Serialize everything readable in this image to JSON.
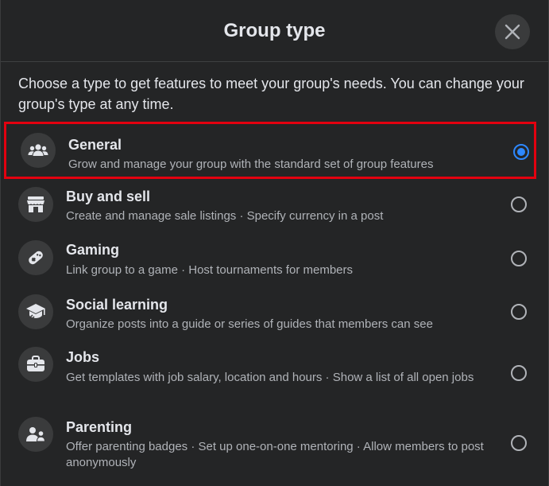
{
  "dialog": {
    "title": "Group type",
    "intro": "Choose a type to get features to meet your group's needs. You can change your group's type at any time.",
    "close_icon": "close-icon"
  },
  "options": [
    {
      "title": "General",
      "description": "Grow and manage your group with the standard set of group features",
      "icon": "people-group-icon",
      "selected": true
    },
    {
      "title": "Buy and sell",
      "description": "Create and manage sale listings · Specify currency in a post",
      "icon": "storefront-icon",
      "selected": false
    },
    {
      "title": "Gaming",
      "description": "Link group to a game · Host tournaments for members",
      "icon": "game-controller-icon",
      "selected": false
    },
    {
      "title": "Social learning",
      "description": "Organize posts into a guide or series of guides that members can see",
      "icon": "graduation-cap-icon",
      "selected": false
    },
    {
      "title": "Jobs",
      "description": "Get templates with job salary, location and hours · Show a list of all open jobs",
      "icon": "briefcase-icon",
      "selected": false
    },
    {
      "title": "Parenting",
      "description": "Offer parenting badges · Set up one-on-one mentoring · Allow members to post anonymously",
      "icon": "parent-child-icon",
      "selected": false
    }
  ],
  "colors": {
    "background": "#242526",
    "accent": "#2d88ff",
    "highlight_border": "#e3000f",
    "primary_text": "#e4e6eb",
    "secondary_text": "#b0b3b8"
  }
}
